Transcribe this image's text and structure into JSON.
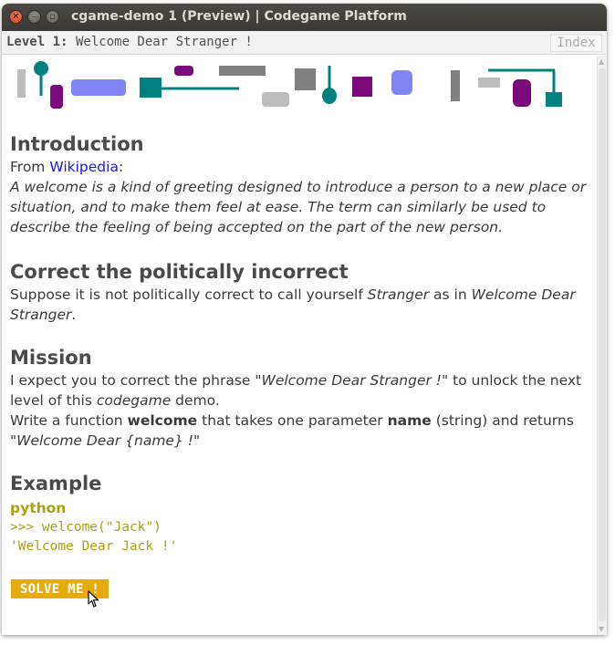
{
  "window": {
    "title": "cgame-demo 1 (Preview) | Codegame Platform",
    "close_glyph": "✕",
    "min_glyph": "–",
    "max_glyph": "▫"
  },
  "levelbar": {
    "level_label": "Level 1:",
    "level_title": "Welcome Dear Stranger !",
    "index_label": "Index"
  },
  "intro": {
    "heading": "Introduction",
    "from_label": "From",
    "source_link": "Wikipedia",
    "source_colon": ":",
    "quote": "A welcome is a kind of greeting designed to introduce a person to a new place or situation, and to make them feel at ease. The term can similarly be used to describe the feeling of being accepted on the part of the new person."
  },
  "correct": {
    "heading": "Correct the politically incorrect",
    "text_1": "Suppose it is not politically correct to call yourself ",
    "em_1": "Stranger",
    "text_2": " as in ",
    "em_2": "Welcome Dear Stranger",
    "text_3": "."
  },
  "mission": {
    "heading": "Mission",
    "line1_a": "I expect you to correct the phrase \"",
    "line1_em": "Welcome Dear Stranger !",
    "line1_b": "\" to unlock the next level of this ",
    "line1_em2": "codegame",
    "line1_c": " demo.",
    "line2_a": "Write a function ",
    "line2_strong1": "welcome",
    "line2_b": " that takes one parameter ",
    "line2_strong2": "name",
    "line2_c": " (string) and returns \"",
    "line2_em": "Welcome Dear {name} !",
    "line2_d": "\""
  },
  "example": {
    "heading": "Example",
    "language": "python",
    "code_line1": ">>> welcome(\"Jack\")",
    "code_line2": "'Welcome Dear Jack !'"
  },
  "solve_button": "SOLVE ME !",
  "colors": {
    "teal": "#00807f",
    "purple": "#7a0a7c",
    "periwinkle": "#8085f5",
    "gray": "#808080",
    "light_gray": "#bdbdbd",
    "code": "#a9a013",
    "button": "#e7ab12",
    "link": "#1a1ae0"
  }
}
